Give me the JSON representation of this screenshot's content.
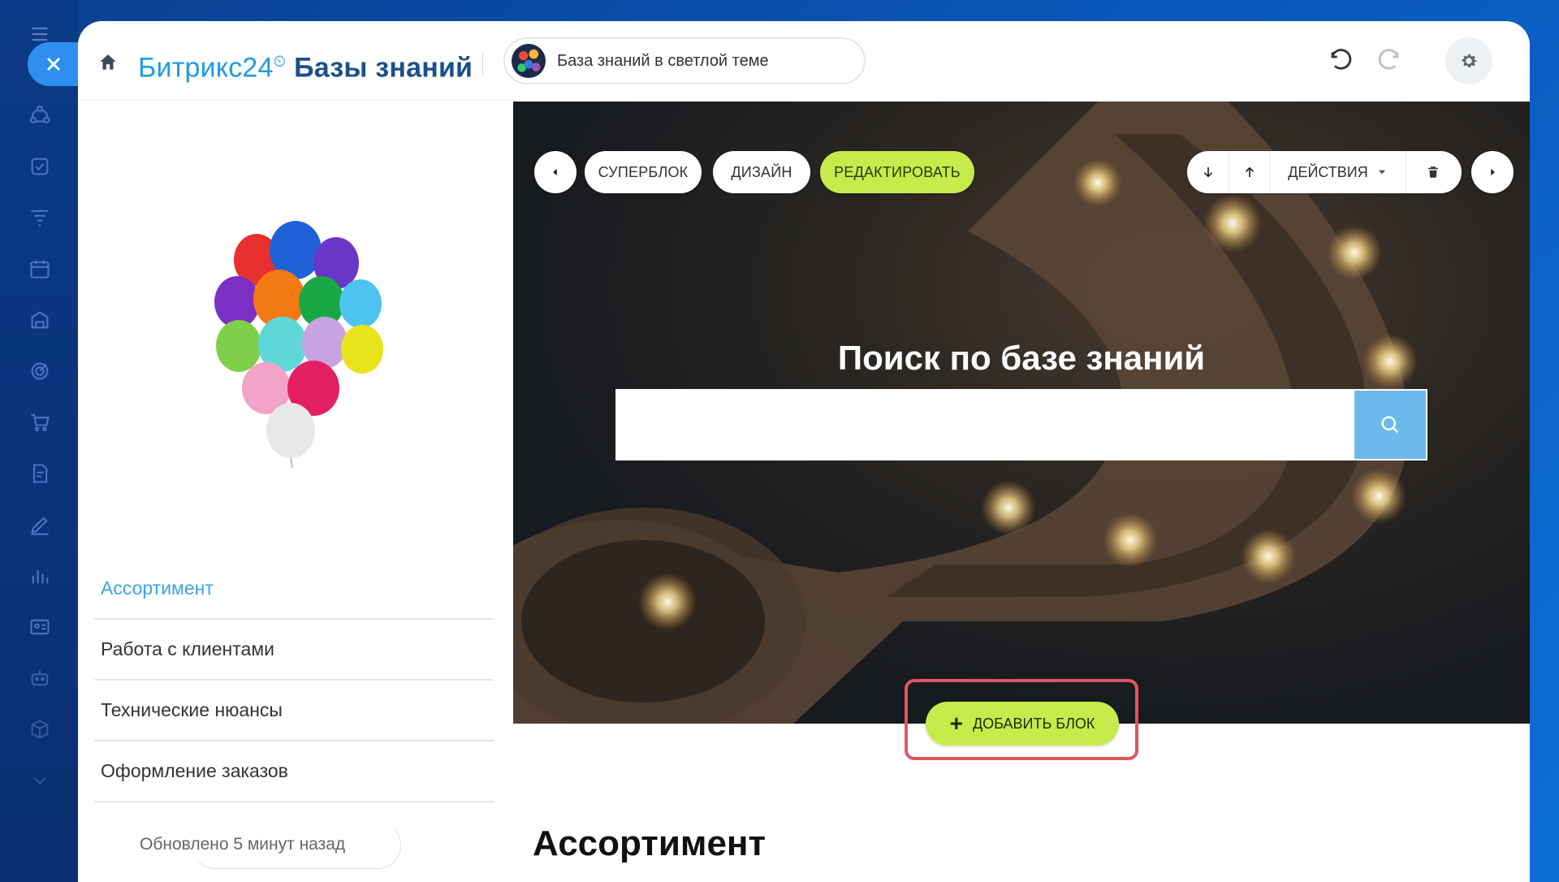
{
  "header": {
    "brand": "Битрикс24",
    "brand_suffix": "Базы знаний",
    "site_name": "База знаний в светлой теме"
  },
  "toolbar": {
    "superblock": "СУПЕРБЛОК",
    "design": "ДИЗАЙН",
    "edit": "РЕДАКТИРОВАТЬ",
    "actions": "ДЕЙСТВИЯ"
  },
  "hero": {
    "title": "Поиск по базе знаний",
    "search_placeholder": ""
  },
  "sidebar": {
    "items": [
      {
        "label": "Ассортимент"
      },
      {
        "label": "Работа с клиентами"
      },
      {
        "label": "Технические нюансы"
      },
      {
        "label": "Оформление заказов"
      }
    ],
    "updated": "Обновлено 5 минут назад"
  },
  "add_block": {
    "label": "ДОБАВИТЬ БЛОК"
  },
  "section": {
    "heading": "Ассортимент"
  },
  "colors": {
    "accent": "#c7eb4a",
    "brand": "#1f9ce0",
    "search_button": "#6cb9ee",
    "highlight": "#e05562"
  }
}
